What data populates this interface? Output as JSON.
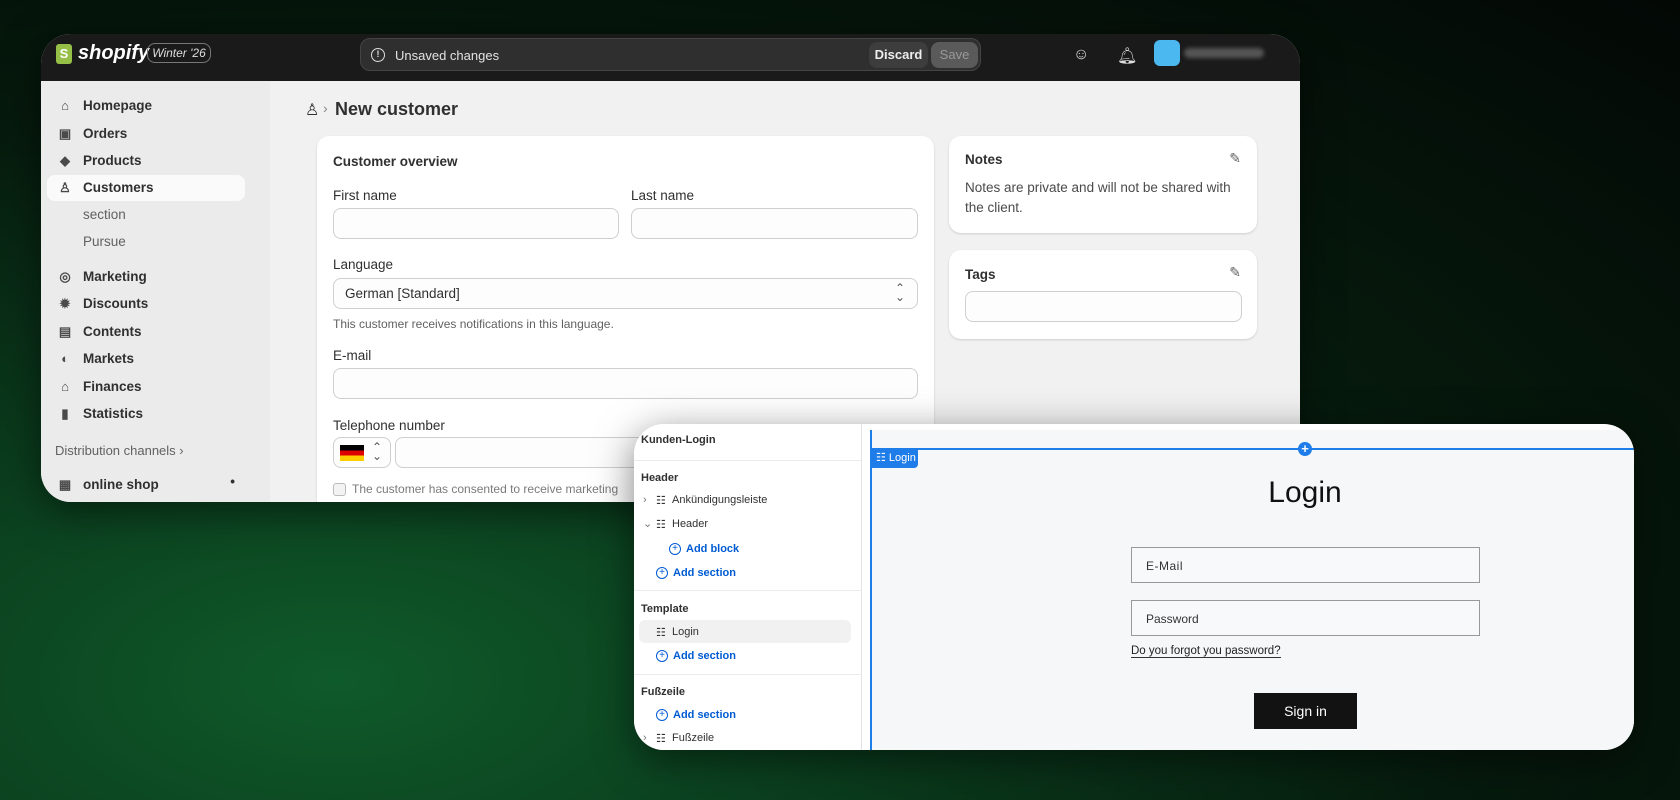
{
  "topbar": {
    "logo_mark": "S",
    "logo": "shopify",
    "edition": "Winter '26",
    "unsaved": "Unsaved changes",
    "discard": "Discard",
    "save": "Save"
  },
  "sidebar": {
    "items": [
      {
        "label": "Homepage",
        "icon": "home-icon"
      },
      {
        "label": "Orders",
        "icon": "inbox-icon"
      },
      {
        "label": "Products",
        "icon": "tag-icon"
      },
      {
        "label": "Customers",
        "icon": "person-icon"
      },
      {
        "label": "section"
      },
      {
        "label": "Pursue"
      },
      {
        "label": "Marketing",
        "icon": "target-icon"
      },
      {
        "label": "Discounts",
        "icon": "discount-icon"
      },
      {
        "label": "Contents",
        "icon": "image-icon"
      },
      {
        "label": "Markets",
        "icon": "globe-icon"
      },
      {
        "label": "Finances",
        "icon": "bank-icon"
      },
      {
        "label": "Statistics",
        "icon": "chart-icon"
      }
    ],
    "distribution": "Distribution channels ›",
    "online_shop": "online shop"
  },
  "page": {
    "title": "New customer"
  },
  "overview": {
    "title": "Customer overview",
    "first_name": "First name",
    "last_name": "Last name",
    "language": "Language",
    "language_value": "German [Standard]",
    "language_help": "This customer receives notifications in this language.",
    "email": "E-mail",
    "phone": "Telephone number",
    "consent": "The customer has consented to receive marketing"
  },
  "notes": {
    "title": "Notes",
    "text": "Notes are private and will not be shared with the client."
  },
  "tags": {
    "title": "Tags"
  },
  "editor": {
    "title": "Kunden-Login",
    "header_group": "Header",
    "announcement": "Ankündigungsleiste",
    "header": "Header",
    "add_block": "Add block",
    "add_section": "Add section",
    "template_group": "Template",
    "login_item": "Login",
    "footer_group": "Fußzeile",
    "footer": "Fußzeile"
  },
  "preview": {
    "tag": "Login",
    "heading": "Login",
    "email_placeholder": "E-Mail",
    "password_placeholder": "Password",
    "forgot": "Do you forgot you password?",
    "sign_in": "Sign in"
  }
}
